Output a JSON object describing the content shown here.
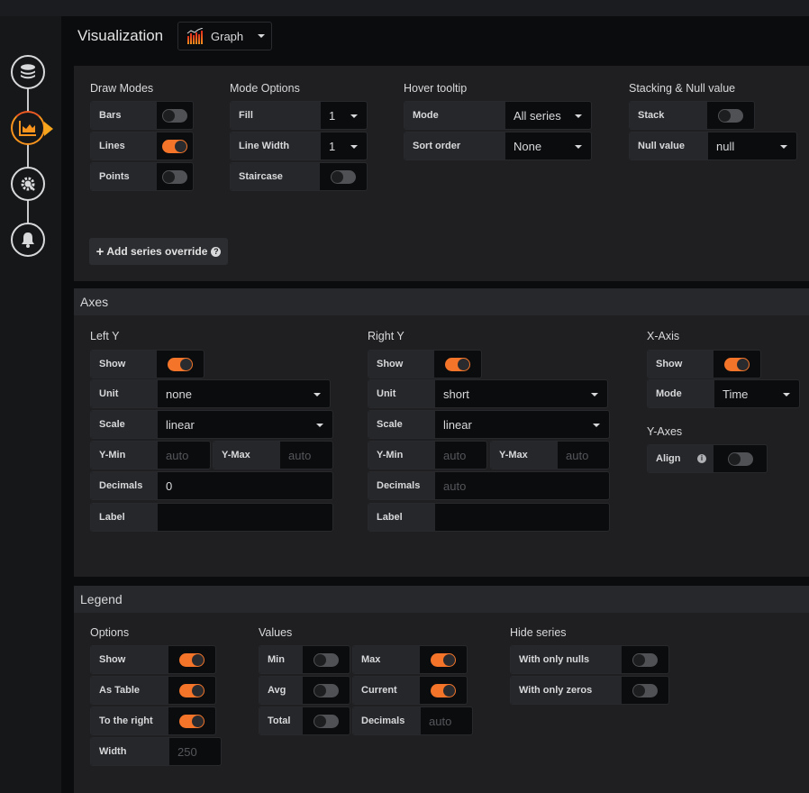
{
  "sidebar": {
    "items": [
      {
        "name": "queries",
        "icon": "database-icon",
        "active": false
      },
      {
        "name": "visualization",
        "icon": "chart-area-icon",
        "active": true
      },
      {
        "name": "general",
        "icon": "gear-wrench-icon",
        "active": false
      },
      {
        "name": "alert",
        "icon": "bell-icon",
        "active": false
      }
    ]
  },
  "header": {
    "title": "Visualization",
    "picker": {
      "icon": "graph-bars-icon",
      "label": "Graph"
    }
  },
  "display": {
    "draw_modes": {
      "title": "Draw Modes",
      "bars": {
        "label": "Bars",
        "on": false
      },
      "lines": {
        "label": "Lines",
        "on": true
      },
      "points": {
        "label": "Points",
        "on": false
      }
    },
    "mode_options": {
      "title": "Mode Options",
      "fill": {
        "label": "Fill",
        "value": "1"
      },
      "line_width": {
        "label": "Line Width",
        "value": "1"
      },
      "staircase": {
        "label": "Staircase",
        "on": false
      }
    },
    "hover_tooltip": {
      "title": "Hover tooltip",
      "mode": {
        "label": "Mode",
        "value": "All series"
      },
      "sort_order": {
        "label": "Sort order",
        "value": "None"
      }
    },
    "stacking": {
      "title": "Stacking & Null value",
      "stack": {
        "label": "Stack",
        "on": false
      },
      "null_value": {
        "label": "Null value",
        "value": "null"
      }
    },
    "add_override": {
      "label": "Add series override",
      "icon": "plus-icon",
      "help_icon": "question-circle-icon"
    }
  },
  "axes": {
    "title": "Axes",
    "left_y": {
      "title": "Left Y",
      "show": {
        "label": "Show",
        "on": true
      },
      "unit": {
        "label": "Unit",
        "value": "none"
      },
      "scale": {
        "label": "Scale",
        "value": "linear"
      },
      "y_min": {
        "label": "Y-Min",
        "placeholder": "auto"
      },
      "y_max": {
        "label": "Y-Max",
        "placeholder": "auto"
      },
      "decimals": {
        "label": "Decimals",
        "value": "0"
      },
      "label": {
        "label": "Label",
        "value": ""
      }
    },
    "right_y": {
      "title": "Right Y",
      "show": {
        "label": "Show",
        "on": true
      },
      "unit": {
        "label": "Unit",
        "value": "short"
      },
      "scale": {
        "label": "Scale",
        "value": "linear"
      },
      "y_min": {
        "label": "Y-Min",
        "placeholder": "auto"
      },
      "y_max": {
        "label": "Y-Max",
        "placeholder": "auto"
      },
      "decimals": {
        "label": "Decimals",
        "placeholder": "auto"
      },
      "label": {
        "label": "Label",
        "value": ""
      }
    },
    "x_axis": {
      "title": "X-Axis",
      "show": {
        "label": "Show",
        "on": true
      },
      "mode": {
        "label": "Mode",
        "value": "Time"
      }
    },
    "y_axes": {
      "title": "Y-Axes",
      "align": {
        "label": "Align",
        "on": false,
        "icon": "info-circle-icon"
      }
    }
  },
  "legend": {
    "title": "Legend",
    "options": {
      "title": "Options",
      "show": {
        "label": "Show",
        "on": true
      },
      "as_table": {
        "label": "As Table",
        "on": true
      },
      "to_right": {
        "label": "To the right",
        "on": true
      },
      "width": {
        "label": "Width",
        "placeholder": "250"
      }
    },
    "values": {
      "title": "Values",
      "min": {
        "label": "Min",
        "on": false
      },
      "max": {
        "label": "Max",
        "on": true
      },
      "avg": {
        "label": "Avg",
        "on": false
      },
      "current": {
        "label": "Current",
        "on": true
      },
      "total": {
        "label": "Total",
        "on": false
      },
      "decimals": {
        "label": "Decimals",
        "placeholder": "auto"
      }
    },
    "hide_series": {
      "title": "Hide series",
      "only_nulls": {
        "label": "With only nulls",
        "on": false
      },
      "only_zeros": {
        "label": "With only zeros",
        "on": false
      }
    }
  },
  "colors": {
    "accent": "#f4752a",
    "accent_light": "#fbca0a",
    "panel": "#1f1f22",
    "input": "#0b0c0e"
  }
}
